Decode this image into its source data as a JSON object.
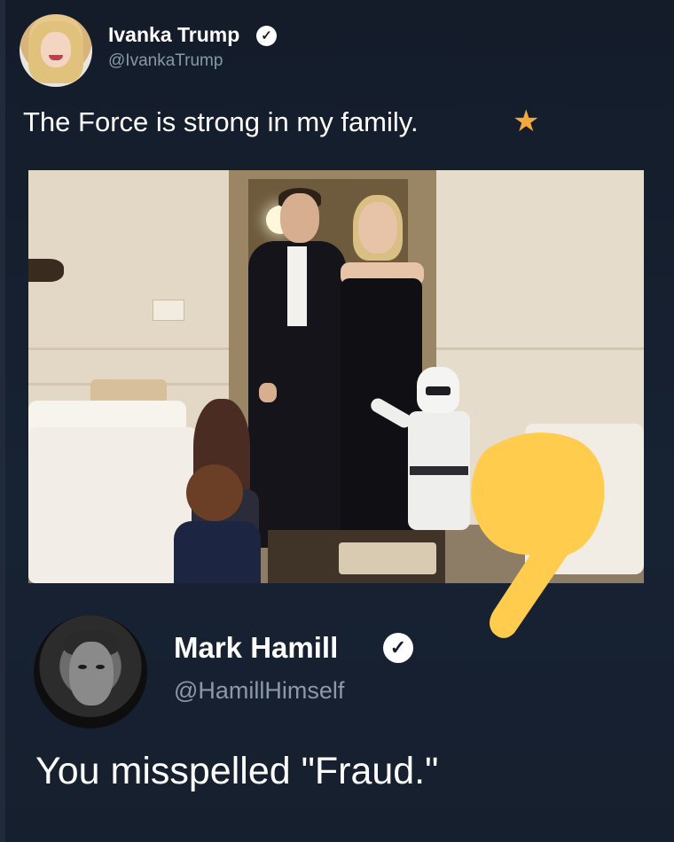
{
  "tweet": {
    "author_name": "Ivanka Trump",
    "author_handle": "@IvankaTrump",
    "text": "The Force is strong in my family.",
    "verified_badge_icon": "verified-badge-icon",
    "emoji_icon": "star-icon"
  },
  "reply": {
    "author_name": "Mark Hamill",
    "author_handle": "@HamillHimself",
    "text": "You misspelled \"Fraud.\"",
    "verified_badge_icon": "verified-badge-icon"
  },
  "overlay": {
    "emoji_icon": "pointing-down-hand-icon"
  },
  "colors": {
    "background": "#15202b",
    "handle_gray": "#8899a6",
    "star": "#f2a93b",
    "hand_emoji": "#ffcc4d"
  }
}
